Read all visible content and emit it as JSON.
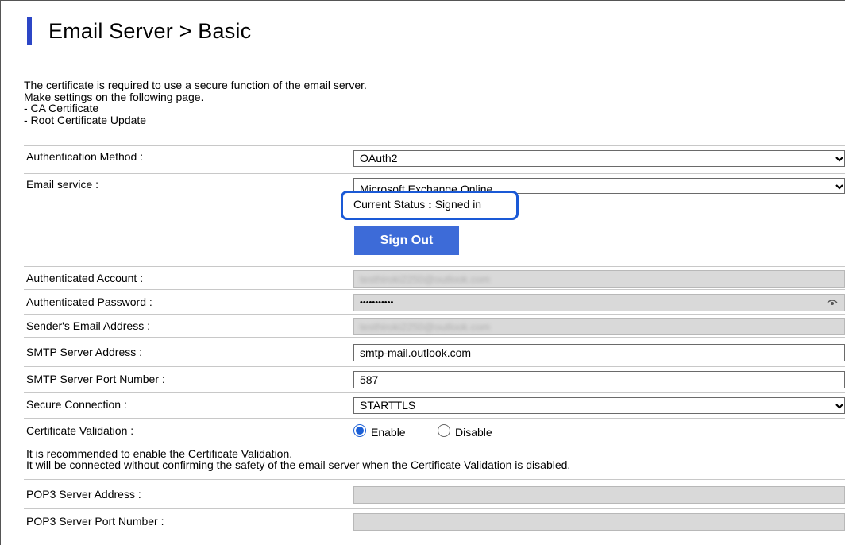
{
  "header": {
    "title": "Email Server > Basic"
  },
  "notice": [
    "The certificate is required to use a secure function of the email server.",
    "Make settings on the following page.",
    "- CA Certificate",
    "- Root Certificate Update"
  ],
  "fields": {
    "auth_method": {
      "label": "Authentication Method :",
      "value": "OAuth2"
    },
    "email_service": {
      "label": "Email service :",
      "value": "Microsoft Exchange Online"
    },
    "status": {
      "label": "Current Status",
      "separator": " : ",
      "value": "Signed in"
    },
    "sign_out_label": "Sign Out",
    "auth_account": {
      "label": "Authenticated Account :",
      "value": "testhiroki2250@outlook.com"
    },
    "auth_password": {
      "label": "Authenticated Password :",
      "value": "•••••••••••"
    },
    "sender_email": {
      "label": "Sender's Email Address :",
      "value": "testhiroki2250@outlook.com"
    },
    "smtp_address": {
      "label": "SMTP Server Address :",
      "value": "smtp-mail.outlook.com"
    },
    "smtp_port": {
      "label": "SMTP Server Port Number :",
      "value": "587"
    },
    "secure_connection": {
      "label": "Secure Connection :",
      "value": "STARTTLS"
    },
    "cert_validation": {
      "label": "Certificate Validation :",
      "enable_label": "Enable",
      "disable_label": "Disable",
      "selected": "Enable"
    },
    "pop3_address": {
      "label": "POP3 Server Address :",
      "value": ""
    },
    "pop3_port": {
      "label": "POP3 Server Port Number :",
      "value": ""
    }
  },
  "recommendation": [
    "It is recommended to enable the Certificate Validation.",
    "It will be connected without confirming the safety of the email server when the Certificate Validation is disabled."
  ],
  "colors": {
    "accent_bar": "#2c46c6",
    "highlight_border": "#1a59d6",
    "button_bg": "#3d6bd8"
  },
  "icons": {
    "dropdown": "chevron-down-icon",
    "password_toggle": "eye-icon"
  }
}
